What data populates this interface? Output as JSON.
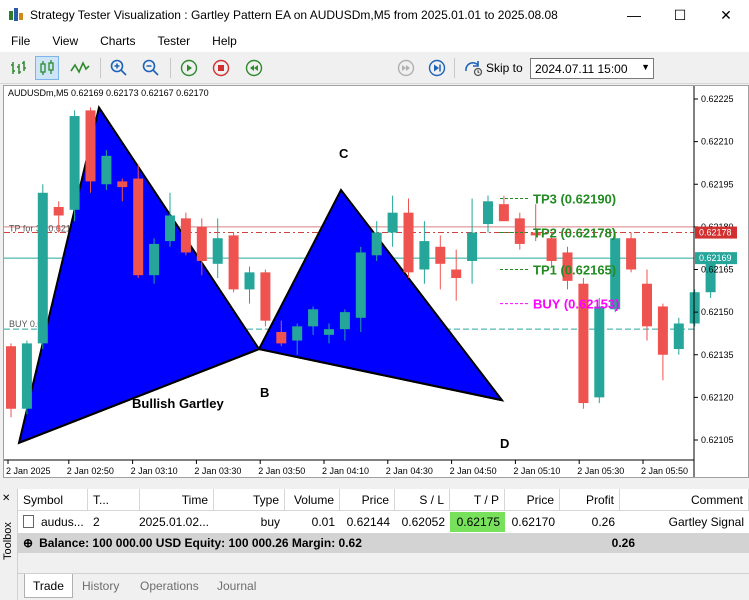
{
  "window": {
    "title": "Strategy Tester Visualization : Gartley Pattern EA on AUDUSDm,M5 from 2025.01.01 to 2025.08.08",
    "minimize_glyph": "—",
    "maximize_glyph": "☐",
    "close_glyph": "✕"
  },
  "menu": [
    "File",
    "View",
    "Charts",
    "Tester",
    "Help"
  ],
  "toolbar": {
    "icons": [
      "bar-chart-icon",
      "candlestick-icon",
      "line-chart-icon",
      "zoom-in-icon",
      "zoom-out-icon",
      "play-icon",
      "stop-icon",
      "rewind-icon",
      "step-forward-icon",
      "skip-end-icon",
      "skip-to-icon"
    ],
    "skip_label": "Skip to",
    "skip_date": "2024.07.11 15:00"
  },
  "chart": {
    "symbol_info": "AUDUSDm,M5  0.62169 0.62173 0.62167 0.62170",
    "price_labels": [
      "0.62225",
      "0.62210",
      "0.62195",
      "0.62180",
      "0.62165",
      "0.62150",
      "0.62135",
      "0.62120",
      "0.62105"
    ],
    "time_labels": [
      "2 Jan 2025",
      "2 Jan 02:50",
      "2 Jan 03:10",
      "2 Jan 03:30",
      "2 Jan 03:50",
      "2 Jan 04:10",
      "2 Jan 04:30",
      "2 Jan 04:50",
      "2 Jan 05:10",
      "2 Jan 05:30",
      "2 Jan 05:50"
    ],
    "tp_price_tag": "0.62178",
    "current_price_tag": "0.62169",
    "tp_line_label": "TP for 3...0.6217",
    "buy_line_label": "BUY 0.0...0.62144",
    "point_labels": {
      "B": "B",
      "C": "C",
      "D": "D"
    },
    "pattern_name": "Bullish Gartley",
    "tp3": "TP3 (0.62190)",
    "tp2": "TP2 (0.62178)",
    "tp1": "TP1 (0.62165)",
    "buy": "BUY (0.62153)",
    "colors": {
      "bull": "#26a69a",
      "bear": "#ef5350",
      "pattern": "#0000ff",
      "tp": "#228b22",
      "buy": "#ff00ff"
    },
    "candles": [
      {
        "o": 62138,
        "h": 62139,
        "l": 62113,
        "c": 62116
      },
      {
        "o": 62116,
        "h": 62140,
        "l": 62114,
        "c": 62139
      },
      {
        "o": 62139,
        "h": 62195,
        "l": 62137,
        "c": 62192
      },
      {
        "o": 62187,
        "h": 62189,
        "l": 62178,
        "c": 62184
      },
      {
        "o": 62186,
        "h": 62221,
        "l": 62182,
        "c": 62219
      },
      {
        "o": 62221,
        "h": 62222,
        "l": 62192,
        "c": 62196
      },
      {
        "o": 62195,
        "h": 62207,
        "l": 62193,
        "c": 62205
      },
      {
        "o": 62196,
        "h": 62197,
        "l": 62189,
        "c": 62194
      },
      {
        "o": 62197,
        "h": 62202,
        "l": 62162,
        "c": 62163
      },
      {
        "o": 62163,
        "h": 62176,
        "l": 62160,
        "c": 62174
      },
      {
        "o": 62175,
        "h": 62192,
        "l": 62173,
        "c": 62184
      },
      {
        "o": 62183,
        "h": 62185,
        "l": 62170,
        "c": 62171
      },
      {
        "o": 62180,
        "h": 62183,
        "l": 62163,
        "c": 62168
      },
      {
        "o": 62167,
        "h": 62183,
        "l": 62162,
        "c": 62176
      },
      {
        "o": 62177,
        "h": 62178,
        "l": 62157,
        "c": 62158
      },
      {
        "o": 62158,
        "h": 62166,
        "l": 62153,
        "c": 62164
      },
      {
        "o": 62164,
        "h": 62165,
        "l": 62145,
        "c": 62147
      },
      {
        "o": 62143,
        "h": 62147,
        "l": 62138,
        "c": 62139
      },
      {
        "o": 62140,
        "h": 62146,
        "l": 62135,
        "c": 62145
      },
      {
        "o": 62145,
        "h": 62152,
        "l": 62142,
        "c": 62151
      },
      {
        "o": 62142,
        "h": 62146,
        "l": 62139,
        "c": 62144
      },
      {
        "o": 62144,
        "h": 62151,
        "l": 62140,
        "c": 62150
      },
      {
        "o": 62148,
        "h": 62173,
        "l": 62143,
        "c": 62171
      },
      {
        "o": 62170,
        "h": 62182,
        "l": 62168,
        "c": 62178
      },
      {
        "o": 62178,
        "h": 62191,
        "l": 62173,
        "c": 62185
      },
      {
        "o": 62185,
        "h": 62190,
        "l": 62162,
        "c": 62164
      },
      {
        "o": 62165,
        "h": 62182,
        "l": 62160,
        "c": 62175
      },
      {
        "o": 62173,
        "h": 62177,
        "l": 62158,
        "c": 62167
      },
      {
        "o": 62165,
        "h": 62172,
        "l": 62154,
        "c": 62162
      },
      {
        "o": 62168,
        "h": 62190,
        "l": 62160,
        "c": 62178
      },
      {
        "o": 62181,
        "h": 62191,
        "l": 62178,
        "c": 62189
      },
      {
        "o": 62188,
        "h": 62191,
        "l": 62182,
        "c": 62182
      },
      {
        "o": 62183,
        "h": 62185,
        "l": 62172,
        "c": 62174
      },
      {
        "o": 62178,
        "h": 62188,
        "l": 62175,
        "c": 62177
      },
      {
        "o": 62176,
        "h": 62178,
        "l": 62166,
        "c": 62168
      },
      {
        "o": 62171,
        "h": 62173,
        "l": 62158,
        "c": 62161
      },
      {
        "o": 62160,
        "h": 62162,
        "l": 62116,
        "c": 62118
      },
      {
        "o": 62120,
        "h": 62155,
        "l": 62118,
        "c": 62152
      },
      {
        "o": 62151,
        "h": 62178,
        "l": 62150,
        "c": 62176
      },
      {
        "o": 62176,
        "h": 62178,
        "l": 62164,
        "c": 62165
      },
      {
        "o": 62160,
        "h": 62165,
        "l": 62140,
        "c": 62145
      },
      {
        "o": 62152,
        "h": 62153,
        "l": 62126,
        "c": 62135
      },
      {
        "o": 62137,
        "h": 62148,
        "l": 62135,
        "c": 62146
      },
      {
        "o": 62146,
        "h": 62158,
        "l": 62145,
        "c": 62157
      },
      {
        "o": 62157,
        "h": 62169,
        "l": 62155,
        "c": 62168
      },
      {
        "o": 62168,
        "h": 62171,
        "l": 62166,
        "c": 62169
      }
    ]
  },
  "trade_table": {
    "headers": [
      "Symbol",
      "T...",
      "Time",
      "Type",
      "Volume",
      "Price",
      "S / L",
      "T / P",
      "Price",
      "Profit",
      "Comment"
    ],
    "row": [
      "audus...",
      "2",
      "2025.01.02...",
      "buy",
      "0.01",
      "0.62144",
      "0.62052",
      "0.62175",
      "0.62170",
      "0.26",
      "Gartley Signal"
    ],
    "balance": "Balance: 100 000.00 USD  Equity: 100 000.26  Margin: 0.62",
    "balance_profit": "0.26"
  },
  "toolbox_label": "Toolbox",
  "tabs": [
    "Trade",
    "History",
    "Operations",
    "Journal"
  ]
}
